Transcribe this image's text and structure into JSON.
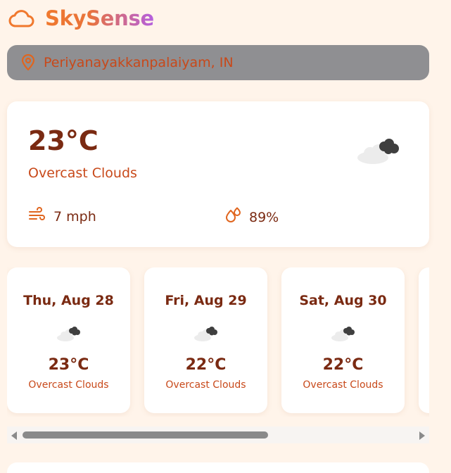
{
  "brand": {
    "title": "SkySense",
    "icon": "cloud-outline-icon",
    "gradient_start": "#f0782d",
    "gradient_end": "#b45fe0"
  },
  "location": {
    "icon": "map-pin-icon",
    "value": "Periyanayakkanpalaiyam, IN"
  },
  "current": {
    "temperature": "23°C",
    "condition": "Overcast Clouds",
    "icon": "overcast-clouds-icon",
    "wind": {
      "icon": "wind-icon",
      "value": "7 mph"
    },
    "humidity": {
      "icon": "humidity-drops-icon",
      "value": "89%"
    }
  },
  "forecast": [
    {
      "day": "Thu, Aug 28",
      "temp": "23°C",
      "condition": "Overcast Clouds",
      "icon": "overcast-clouds-icon"
    },
    {
      "day": "Fri, Aug 29",
      "temp": "22°C",
      "condition": "Overcast Clouds",
      "icon": "overcast-clouds-icon"
    },
    {
      "day": "Sat, Aug 30",
      "temp": "22°C",
      "condition": "Overcast Clouds",
      "icon": "overcast-clouds-icon"
    }
  ],
  "colors": {
    "background": "#fff4ea",
    "primary_text": "#7a2a12",
    "accent_text": "#c8491a",
    "search_bar": "#8f8f92"
  }
}
